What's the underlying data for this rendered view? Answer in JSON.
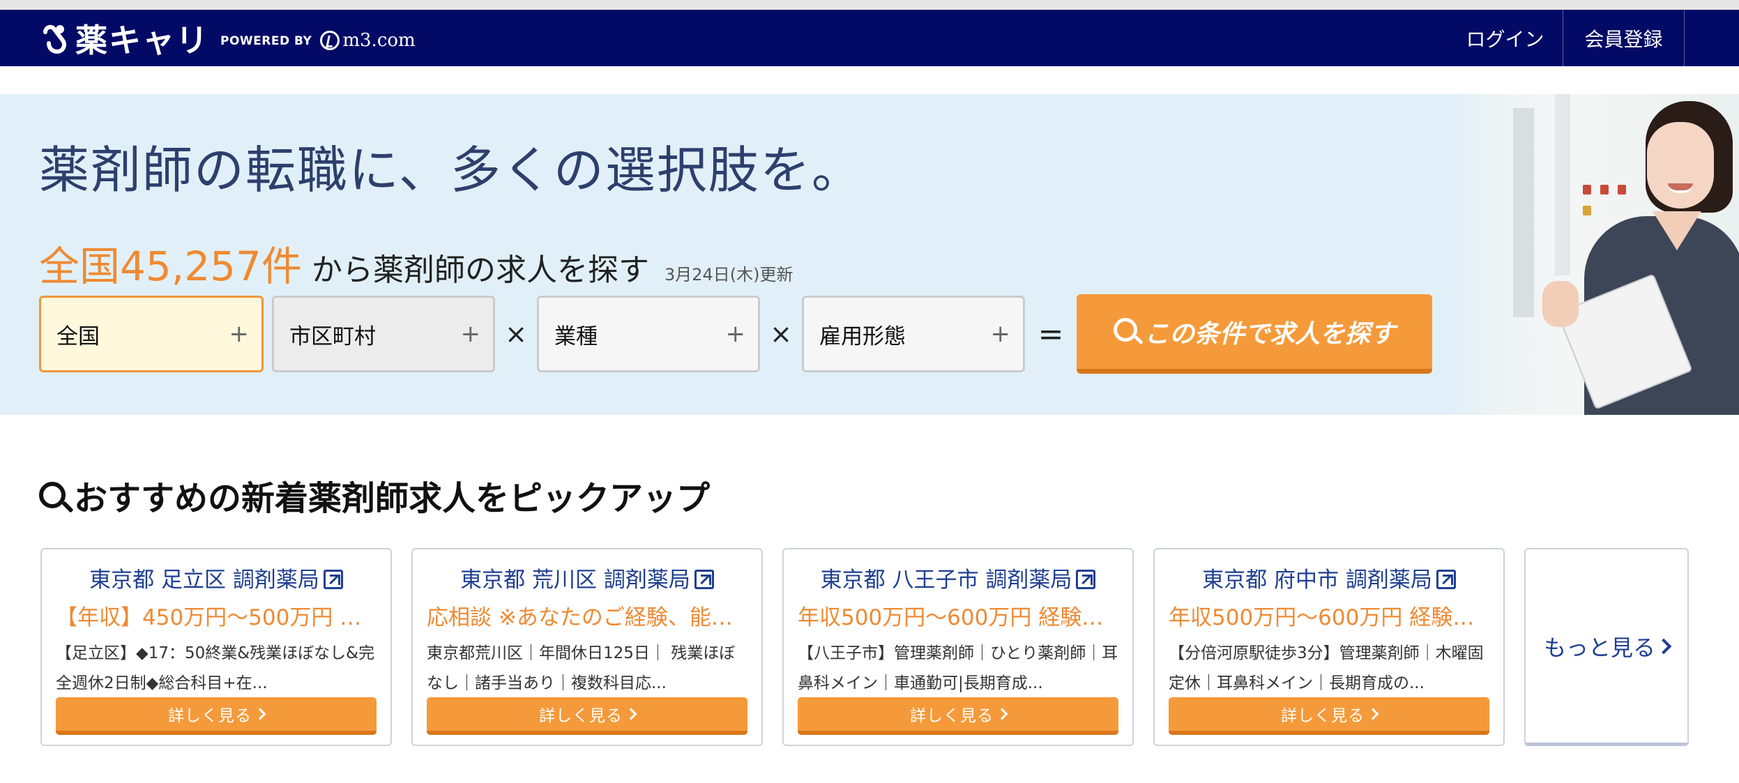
{
  "header": {
    "logo_text": "薬キャリ",
    "powered_by": "POWERED BY",
    "partner": "m3.com",
    "nav": [
      {
        "label": "ログイン"
      },
      {
        "label": "会員登録"
      }
    ],
    "colors": {
      "background": "#020a66",
      "text": "#ffffff"
    }
  },
  "hero": {
    "title": "薬剤師の転職に、多くの選択肢を。",
    "count_highlight": "全国45,257件",
    "count_suffix": "から薬剤師の求人を探す",
    "updated": "3月24日(木)更新",
    "filters": {
      "region": "全国",
      "city": "市区町村",
      "job_type": "業種",
      "employment": "雇用形態"
    },
    "operators": {
      "times": "×",
      "equals": "="
    },
    "search_button": "この条件で求人を探す",
    "colors": {
      "accent": "#ef8a33",
      "background": "#e1f0f8",
      "button": "#f59a3a"
    }
  },
  "pickup": {
    "title": "おすすめの新着薬剤師求人をピックアップ",
    "cards": [
      {
        "title": "東京都 足立区 調剤薬局",
        "salary": "【年収】450万円〜500万円 …",
        "desc": "【足立区】◆17：50終業&残業ほぼなし&完全週休2日制◆総合科目+在...",
        "button": "詳しく見る"
      },
      {
        "title": "東京都 荒川区 調剤薬局",
        "salary": "応相談 ※あなたのご経験、能…",
        "desc": "東京都荒川区｜年間休日125日｜ 残業ほぼなし｜諸手当あり｜複数科目応...",
        "button": "詳しく見る"
      },
      {
        "title": "東京都 八王子市 調剤薬局",
        "salary": "年収500万円〜600万円 経験…",
        "desc": "【八王子市】管理薬剤師｜ひとり薬剤師｜耳鼻科メイン｜車通勤可|長期育成...",
        "button": "詳しく見る"
      },
      {
        "title": "東京都 府中市 調剤薬局",
        "salary": "年収500万円〜600万円 経験…",
        "desc": "【分倍河原駅徒歩3分】管理薬剤師｜木曜固定休｜耳鼻科メイン｜長期育成の...",
        "button": "詳しく見る"
      }
    ],
    "more": "もっと見る",
    "colors": {
      "title_link": "#1e3f91",
      "salary": "#ef8a33",
      "button": "#f59a3a"
    }
  }
}
